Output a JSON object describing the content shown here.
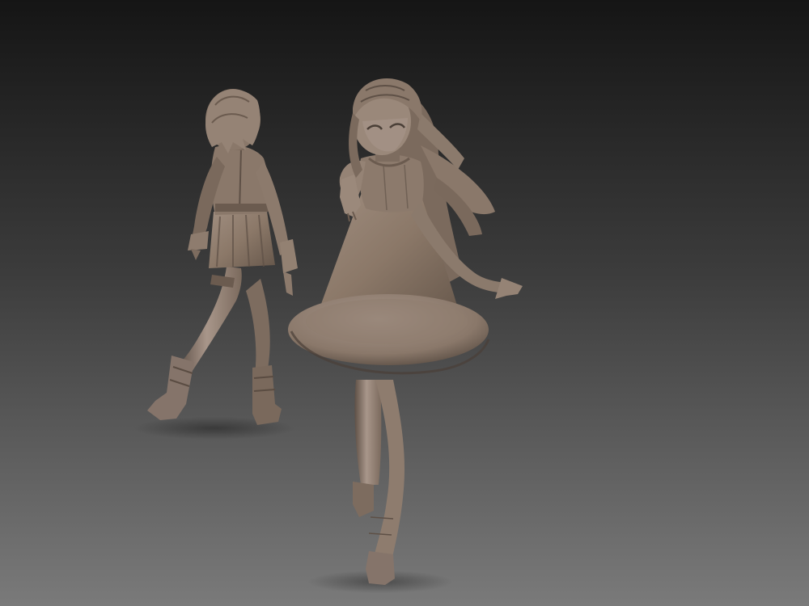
{
  "scene": {
    "kind": "3d-sculpt-render",
    "colors": {
      "background_top": "#151515",
      "background_bottom": "#7a7a7a",
      "clay_base": "#8b7868",
      "clay_light": "#a8968a",
      "clay_shadow": "#5e5046",
      "clay_dark": "#4a3f37",
      "floor_shadow": "#4e4e4e"
    }
  }
}
